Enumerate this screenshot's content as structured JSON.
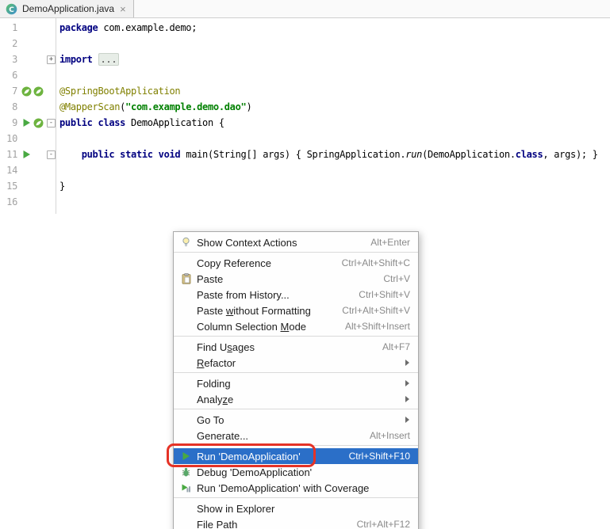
{
  "tab": {
    "title": "DemoApplication.java",
    "close_label": "×"
  },
  "colors": {
    "selection_blue": "#2B6FC8",
    "annotation_red": "#E53226",
    "run_green": "#49A942",
    "spring_green": "#6DB33F",
    "keyword_navy": "#000080",
    "string_green": "#008000",
    "annotation_olive": "#808000"
  },
  "editor": {
    "lines": [
      {
        "num": "1",
        "tokens": [
          [
            "kw",
            "package"
          ],
          [
            "pl",
            " com.example.demo;"
          ]
        ]
      },
      {
        "num": "2",
        "tokens": []
      },
      {
        "num": "3",
        "fold": "+",
        "tokens": [
          [
            "kw",
            "import"
          ],
          [
            "pl",
            " "
          ],
          [
            "folded",
            "..."
          ]
        ]
      },
      {
        "num": "6",
        "tokens": []
      },
      {
        "num": "7",
        "icons": [
          "spring-bean-icon",
          "spring-bean-icon"
        ],
        "tokens": [
          [
            "ann",
            "@SpringBootApplication"
          ]
        ]
      },
      {
        "num": "8",
        "tokens": [
          [
            "ann",
            "@MapperScan"
          ],
          [
            "pl",
            "("
          ],
          [
            "str",
            "\"com.example.demo.dao\""
          ],
          [
            "pl",
            ")"
          ]
        ]
      },
      {
        "num": "9",
        "icons": [
          "run-icon",
          "spring-bean-icon"
        ],
        "fold": "-",
        "tokens": [
          [
            "kw",
            "public class"
          ],
          [
            "pl",
            " DemoApplication {"
          ]
        ]
      },
      {
        "num": "10",
        "tokens": []
      },
      {
        "num": "11",
        "icons": [
          "run-icon"
        ],
        "fold": "-",
        "tokens": [
          [
            "pl",
            "    "
          ],
          [
            "kw",
            "public static void"
          ],
          [
            "pl",
            " main(String[] args) { SpringApplication."
          ],
          [
            "it",
            "run"
          ],
          [
            "pl",
            "(DemoApplication."
          ],
          [
            "kw",
            "class"
          ],
          [
            "pl",
            ", args); }"
          ]
        ]
      },
      {
        "num": "14",
        "tokens": []
      },
      {
        "num": "15",
        "tokens": [
          [
            "pl",
            "}"
          ]
        ]
      },
      {
        "num": "16",
        "tokens": []
      }
    ]
  },
  "menu": {
    "items": [
      {
        "type": "item",
        "icon": "lightbulb-icon",
        "label": "Show Context Actions",
        "shortcut": "Alt+Enter"
      },
      {
        "type": "separator"
      },
      {
        "type": "item",
        "label": "Copy Reference",
        "shortcut": "Ctrl+Alt+Shift+C"
      },
      {
        "type": "item",
        "icon": "paste-icon",
        "label": "Paste",
        "shortcut": "Ctrl+V"
      },
      {
        "type": "item",
        "label": "Paste from History...",
        "shortcut": "Ctrl+Shift+V"
      },
      {
        "type": "item",
        "label": "Paste without Formatting",
        "mnemonic_index": 6,
        "shortcut": "Ctrl+Alt+Shift+V"
      },
      {
        "type": "item",
        "label": "Column Selection Mode",
        "mnemonic_index": 17,
        "shortcut": "Alt+Shift+Insert"
      },
      {
        "type": "separator"
      },
      {
        "type": "item",
        "label": "Find Usages",
        "mnemonic_index": 6,
        "shortcut": "Alt+F7"
      },
      {
        "type": "item",
        "label": "Refactor",
        "mnemonic_index": 0,
        "submenu": true
      },
      {
        "type": "separator"
      },
      {
        "type": "item",
        "label": "Folding",
        "submenu": true
      },
      {
        "type": "item",
        "label": "Analyze",
        "mnemonic_index": 5,
        "submenu": true
      },
      {
        "type": "separator"
      },
      {
        "type": "item",
        "label": "Go To",
        "submenu": true
      },
      {
        "type": "item",
        "label": "Generate...",
        "shortcut": "Alt+Insert"
      },
      {
        "type": "separator"
      },
      {
        "type": "item",
        "icon": "run-icon",
        "label": "Run 'DemoApplication'",
        "shortcut": "Ctrl+Shift+F10",
        "selected": true
      },
      {
        "type": "item",
        "icon": "debug-icon",
        "label": "Debug 'DemoApplication'"
      },
      {
        "type": "item",
        "icon": "run-coverage-icon",
        "label": "Run 'DemoApplication' with Coverage"
      },
      {
        "type": "separator"
      },
      {
        "type": "item",
        "label": "Show in Explorer"
      },
      {
        "type": "item",
        "label": "File Path",
        "mnemonic_index": 5,
        "shortcut": "Ctrl+Alt+F12"
      }
    ]
  }
}
